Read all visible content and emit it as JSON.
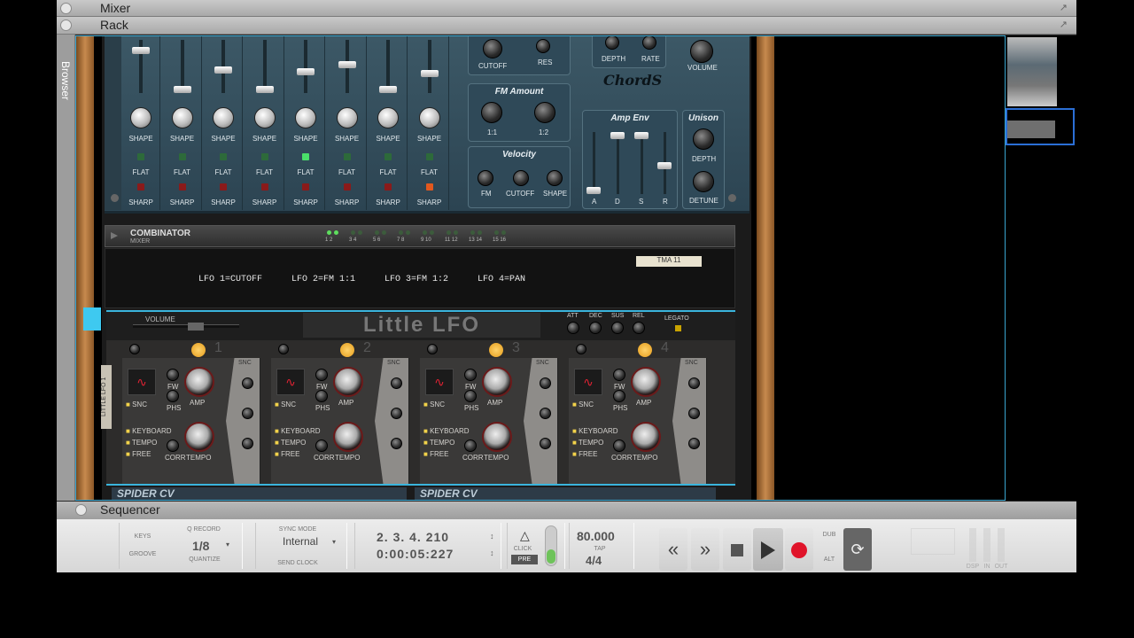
{
  "panels": {
    "mixer": "Mixer",
    "rack": "Rack",
    "browser": "Browser",
    "sequencer": "Sequencer"
  },
  "synth": {
    "channel_knob_label": "SHAPE",
    "flat_label": "FLAT",
    "sharp_label": "SHARP",
    "filter": {
      "cutoff": "CUTOFF",
      "res": "RES"
    },
    "lfo_mod": {
      "depth": "DEPTH",
      "rate": "RATE"
    },
    "volume": "VOLUME",
    "logo": "ChordS",
    "fm_amount": {
      "title": "FM Amount",
      "k1": "1:1",
      "k2": "1:2"
    },
    "velocity": {
      "title": "Velocity",
      "fm": "FM",
      "cutoff": "CUTOFF",
      "shape": "SHAPE"
    },
    "amp_env": {
      "title": "Amp Env",
      "a": "A",
      "d": "D",
      "s": "S",
      "r": "R"
    },
    "unison": {
      "title": "Unison",
      "depth": "DEPTH",
      "detune": "DETUNE"
    }
  },
  "combinator": {
    "name": "COMBINATOR",
    "sub": "MIXER",
    "pads": [
      "1 2",
      "3 4",
      "5 6",
      "7 8",
      "9 10",
      "11 12",
      "13 14",
      "15 16"
    ],
    "labels": [
      "LFO 1=CUTOFF",
      "LFO 2=FM 1:1",
      "LFO 3=FM 1:2",
      "LFO 4=PAN"
    ],
    "tape": "TMA 11"
  },
  "little_lfo": {
    "title": "Little LFO",
    "volume": "VOLUME",
    "side_label": "LITTLE LFO 1",
    "env": {
      "att": "ATT",
      "dec": "DEC",
      "sus": "SUS",
      "rel": "REL",
      "legato": "LEGATO"
    },
    "sections": [
      "1",
      "2",
      "3",
      "4"
    ],
    "labels": {
      "fw": "FW",
      "phs": "PHS",
      "amp": "AMP",
      "snc": "SNC",
      "keyboard": "KEYBOARD",
      "tempo": "TEMPO",
      "free": "FREE",
      "corr": "CORR",
      "snc_top": "SNC"
    }
  },
  "spider": {
    "left": "SPIDER CV",
    "right": "SPIDER CV"
  },
  "transport": {
    "keys": "KEYS",
    "groove": "GROOVE",
    "q_record": "Q RECORD",
    "quantize_value": "1/8",
    "quantize": "QUANTIZE",
    "sync_mode": "SYNC MODE",
    "sync_value": "Internal",
    "send_clock": "SEND CLOCK",
    "position_bars": "2.  3.  4. 210",
    "position_time": "0:00:05:227",
    "click": "CLICK",
    "pre": "PRE",
    "tempo": "80.000",
    "tap": "TAP",
    "signature": "4/4",
    "dub": "DUB",
    "alt": "ALT",
    "dsp": "DSP",
    "in": "IN",
    "out": "OUT"
  },
  "colors": {
    "rack_border": "#3aa6d0",
    "synth_panel": "#35505e",
    "record": "#e0142a"
  }
}
